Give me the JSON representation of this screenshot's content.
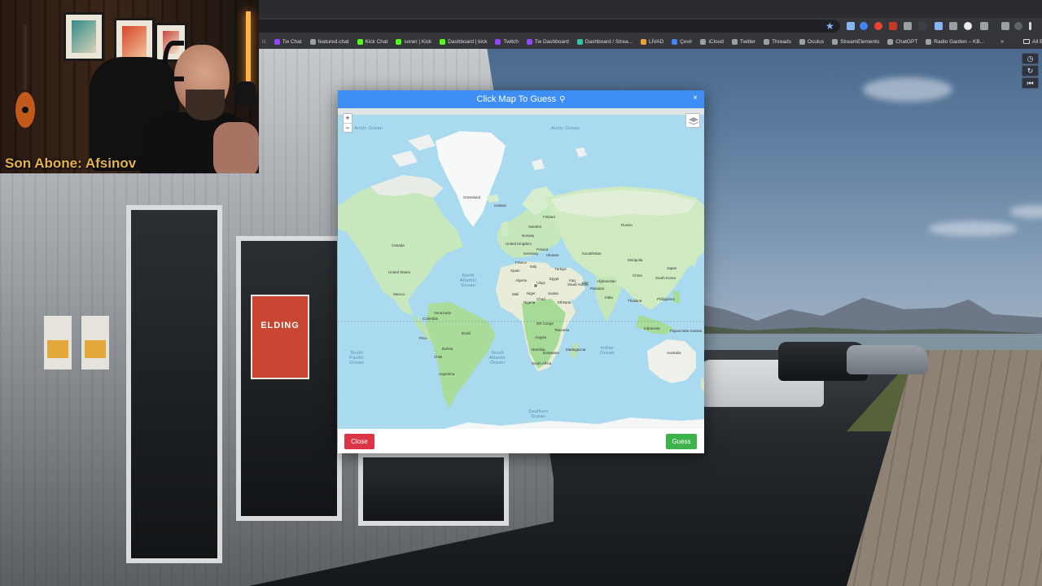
{
  "webcam": {
    "caption": "Son Abone: Afsinov"
  },
  "browser": {
    "bookmarks": [
      {
        "label": "Tw Chat",
        "color": "#9146ff"
      },
      {
        "label": "featured.chat",
        "color": "#9aa0a6"
      },
      {
        "label": "Kick Chat",
        "color": "#53fc18"
      },
      {
        "label": "soner | Kick",
        "color": "#53fc18"
      },
      {
        "label": "Dashboard | kick",
        "color": "#53fc18"
      },
      {
        "label": "Twitch",
        "color": "#9146ff"
      },
      {
        "label": "Tw Dashboard",
        "color": "#9146ff"
      },
      {
        "label": "Dashboard / Strea...",
        "color": "#31c3a2"
      },
      {
        "label": "LİVAD",
        "color": "#e8a33d"
      },
      {
        "label": "Çevir",
        "color": "#4285f4"
      },
      {
        "label": "iCloud",
        "color": "#9aa0a6"
      },
      {
        "label": "Twitter",
        "color": "#9aa0a6"
      },
      {
        "label": "Threads",
        "color": "#9aa0a6"
      },
      {
        "label": "Oculus",
        "color": "#9aa0a6"
      },
      {
        "label": "StreamElements",
        "color": "#9aa0a6"
      },
      {
        "label": "ChatGPT",
        "color": "#9aa0a6"
      },
      {
        "label": "Radio Garden – KB...",
        "color": "#9aa0a6"
      }
    ],
    "more": "»",
    "all_bookmarks": "All Bookmarks"
  },
  "modal": {
    "title": "Click Map To Guess",
    "close_x": "×",
    "close_button": "Close",
    "guess_button": "Guess"
  },
  "map": {
    "zoom_in": "+",
    "zoom_out": "−",
    "oceans": {
      "arctic_left": "Arctic Ocean",
      "arctic_right": "Arctic Ocean",
      "north_atlantic": "North\nAtlantic\nOcean",
      "south_pacific": "South\nPacific\nOcean",
      "south_atlantic": "South\nAtlantic\nOcean",
      "indian": "Indian\nOcean",
      "southern": "Southern\nOcean"
    },
    "countries": {
      "greenland": "Greenland",
      "canada": "Canada",
      "united_states": "United States",
      "mexico": "Mexico",
      "venezuela": "Venezuela",
      "colombia": "Colombia",
      "peru": "Peru",
      "brazil": "Brazil",
      "bolivia": "Bolivia",
      "chile": "Chile",
      "argentina": "Argentina",
      "iceland": "Iceland",
      "norway": "Norway",
      "finland": "Finland",
      "sweden": "Sweden",
      "united_kingdom": "United Kingdom",
      "france": "France",
      "germany": "Germany",
      "spain": "Spain",
      "italy": "Italy",
      "poland": "Poland",
      "ukraine": "Ukraine",
      "turkiye": "Türkiye",
      "russia": "Russia",
      "kazakhstan": "Kazakhstan",
      "mongolia": "Mongolia",
      "china": "China",
      "south_korea": "South Korea",
      "japan": "Japan",
      "iran": "Iran",
      "iraq": "Iraq",
      "afghanistan": "Afghanistan",
      "pakistan": "Pakistan",
      "india": "India",
      "thailand": "Thailand",
      "philippines": "Philippines",
      "indonesia": "Indonesia",
      "papua_new_guinea": "Papua New Guinea",
      "australia": "Australia",
      "algeria": "Algeria",
      "libya": "Libya",
      "egypt": "Egypt",
      "mali": "Mali",
      "niger": "Niger",
      "chad": "Chad",
      "sudan": "Sudan",
      "nigeria": "Nigeria",
      "ethiopia": "Ethiopia",
      "saudi_arabia": "Saudi Arabia",
      "dr_congo": "DR Congo",
      "tanzania": "Tanzania",
      "angola": "Angola",
      "namibia": "Namibia",
      "botswana": "Botswana",
      "south_africa": "South Africa",
      "madagascar": "Madagascar"
    }
  },
  "colors": {
    "header": "#3d8ef7",
    "close_button": "#dc3545",
    "guess_button": "#3cb44b",
    "land": "#cfeac1",
    "ocean": "#aadaef",
    "caption": "#e6b445"
  },
  "icons": {
    "modal_title": "map-pin-icon",
    "bookmark_star": "star-icon",
    "layers": "layers-icon",
    "side_controls": [
      "compass-icon",
      "refresh-icon",
      "rewind-icon"
    ]
  }
}
